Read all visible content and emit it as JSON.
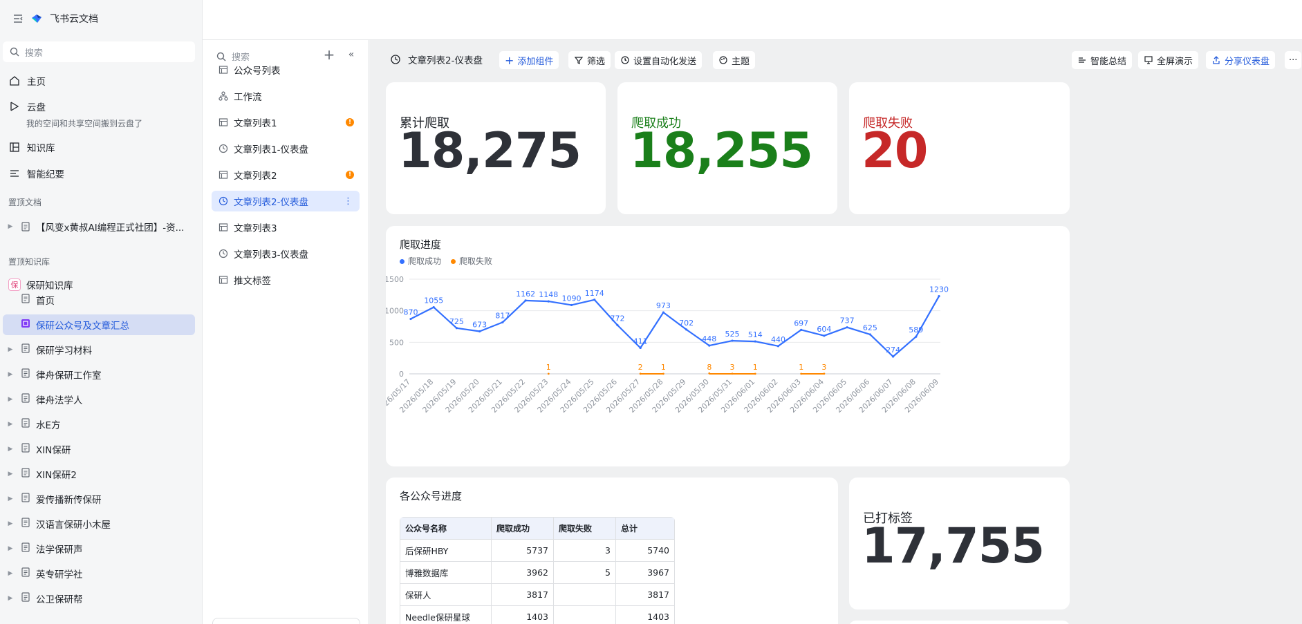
{
  "sidebar": {
    "brand": "飞书云文档",
    "search_placeholder": "搜索",
    "nav": [
      {
        "label": "主页"
      },
      {
        "label": "云盘"
      },
      {
        "label": "知识库"
      },
      {
        "label": "智能纪要"
      }
    ],
    "cloud_subtext": "我的空间和共享空间搬到云盘了",
    "pinned_docs_title": "置顶文档",
    "pinned_doc": "【风变x黄叔AI编程正式社团】-资...",
    "pinned_kb_title": "置顶知识库",
    "kb_badge": "保",
    "kb_name": "保研知识库",
    "tree": [
      "首页",
      "保研公众号及文章汇总",
      "保研学习材料",
      "律舟保研工作室",
      "律舟法学人",
      "水E方",
      "XIN保研",
      "XIN保研2",
      "爱传播新传保研",
      "汉语言保研小木屋",
      "法学保研声",
      "英专研学社",
      "公卫保研帮"
    ]
  },
  "mid": {
    "search_placeholder": "搜索",
    "items": [
      {
        "label": "公众号列表",
        "icon": "table-icon"
      },
      {
        "label": "工作流",
        "icon": "workflow-icon"
      },
      {
        "label": "文章列表1",
        "icon": "table-icon",
        "warn": "!"
      },
      {
        "label": "文章列表1-仪表盘",
        "icon": "dashboard-icon"
      },
      {
        "label": "文章列表2",
        "icon": "table-icon",
        "warn": "!"
      },
      {
        "label": "文章列表2-仪表盘",
        "icon": "dashboard-icon",
        "more": "⋮"
      },
      {
        "label": "文章列表3",
        "icon": "table-icon"
      },
      {
        "label": "文章列表3-仪表盘",
        "icon": "dashboard-icon"
      },
      {
        "label": "推文标签",
        "icon": "table-icon"
      }
    ]
  },
  "toolbar": {
    "title": "文章列表2-仪表盘",
    "add_widget": "添加组件",
    "filter": "筛选",
    "auto_send": "设置自动化发送",
    "theme": "主题",
    "smart_summary": "智能总结",
    "fullscreen": "全屏演示",
    "share": "分享仪表盘",
    "more": "···"
  },
  "stats": {
    "total": {
      "label": "累计爬取",
      "value": "18,275",
      "color": "#2e3138"
    },
    "success": {
      "label": "爬取成功",
      "value": "18,255",
      "color": "#1a7f1a"
    },
    "fail": {
      "label": "爬取失败",
      "value": "20",
      "color": "#c62828"
    },
    "tagged": {
      "label": "已打标签",
      "value": "17,755",
      "color": "#2e3138"
    }
  },
  "progress_title": "爬取进度",
  "table": {
    "title": "各公众号进度",
    "columns": [
      "公众号名称",
      "爬取成功",
      "爬取失败",
      "总计"
    ],
    "rows": [
      [
        "后保研HBY",
        "5737",
        "3",
        "5740"
      ],
      [
        "博雅数据库",
        "3962",
        "5",
        "3967"
      ],
      [
        "保研人",
        "3817",
        "",
        "3817"
      ],
      [
        "Needle保研星球",
        "1403",
        "",
        "1403"
      ]
    ]
  },
  "chart_data": {
    "type": "line",
    "title": "爬取进度",
    "categories": [
      "2026/05/17",
      "2026/05/18",
      "2026/05/19",
      "2026/05/20",
      "2026/05/21",
      "2026/05/22",
      "2026/05/23",
      "2026/05/24",
      "2026/05/25",
      "2026/05/26",
      "2026/05/27",
      "2026/05/28",
      "2026/05/29",
      "2026/05/30",
      "2026/05/31",
      "2026/06/01",
      "2026/06/02",
      "2026/06/03",
      "2026/06/04",
      "2026/06/05",
      "2026/06/06",
      "2026/06/07",
      "2026/06/08",
      "2026/06/09"
    ],
    "ylim": [
      0,
      1500
    ],
    "yticks": [
      0,
      500,
      1000,
      1500
    ],
    "grid": true,
    "legend": "top-left",
    "series": [
      {
        "name": "爬取成功",
        "color": "#3370ff",
        "values": [
          870,
          1055,
          725,
          673,
          817,
          1162,
          1148,
          1090,
          1174,
          772,
          411,
          973,
          702,
          448,
          525,
          514,
          440,
          697,
          604,
          737,
          625,
          274,
          589,
          1230
        ]
      },
      {
        "name": "爬取失败",
        "color": "#ff8800",
        "values": [
          null,
          null,
          null,
          null,
          null,
          null,
          1,
          null,
          null,
          null,
          2,
          1,
          null,
          8,
          3,
          1,
          null,
          1,
          3,
          null,
          null,
          null,
          null,
          null
        ],
        "labels_shown": [
          6,
          10,
          11,
          13,
          14,
          15,
          17,
          18
        ],
        "segments": [
          [
            10,
            11
          ],
          [
            13,
            15
          ],
          [
            17,
            18
          ]
        ]
      }
    ]
  }
}
